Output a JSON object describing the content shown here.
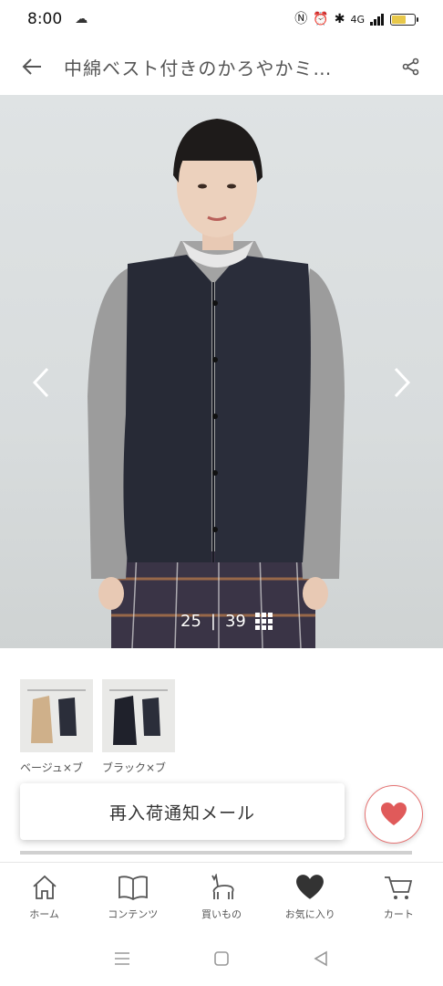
{
  "status": {
    "time": "8:00",
    "network": "4G"
  },
  "header": {
    "title": "中綿ベスト付きのかろやかミ…"
  },
  "gallery": {
    "current": "25",
    "separator": "|",
    "total": "39"
  },
  "swatches": [
    {
      "label": "ベージュ×ブ"
    },
    {
      "label": "ブラック×ブ"
    }
  ],
  "actions": {
    "restock_label": "再入荷通知メール"
  },
  "nav": {
    "home": "ホーム",
    "contents": "コンテンツ",
    "shopping": "買いもの",
    "favorites": "お気に入り",
    "cart": "カート"
  },
  "colors": {
    "favorite_accent": "#e05a5a",
    "battery": "#e8c84a"
  }
}
